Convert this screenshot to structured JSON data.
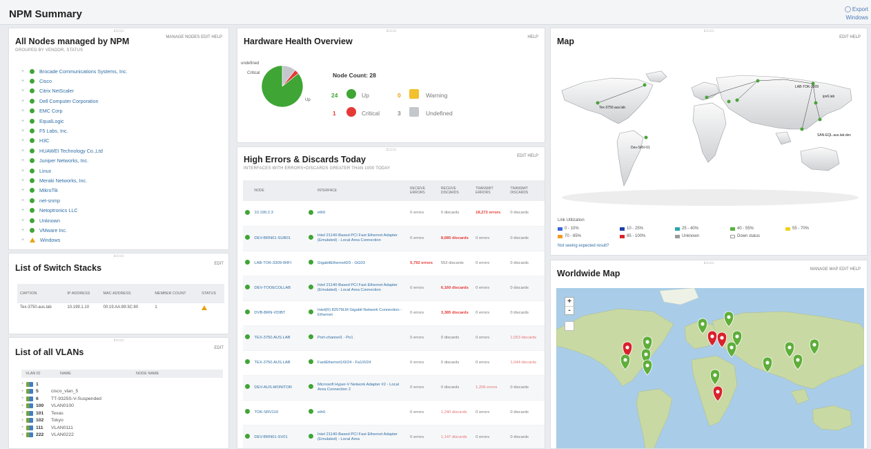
{
  "header": {
    "title": "NPM Summary",
    "export_line1": "Export",
    "export_line2": "Windows"
  },
  "nodes_panel": {
    "title": "All Nodes managed by NPM",
    "subtitle": "GROUPED BY VENDOR, STATUS",
    "links": "MANAGE NODES  EDIT  HELP",
    "items": [
      {
        "label": "Brocade Communications Systems, Inc.",
        "status": "up"
      },
      {
        "label": "Cisco",
        "status": "up"
      },
      {
        "label": "Citrix NetScaler",
        "status": "up"
      },
      {
        "label": "Dell Computer Corporation",
        "status": "up"
      },
      {
        "label": "EMC Corp",
        "status": "up"
      },
      {
        "label": "EqualLogic",
        "status": "up"
      },
      {
        "label": "F5 Labs, Inc.",
        "status": "up"
      },
      {
        "label": "H3C",
        "status": "up"
      },
      {
        "label": "HUAWEI Technology Co.,Ltd",
        "status": "up"
      },
      {
        "label": "Juniper Networks, Inc.",
        "status": "up"
      },
      {
        "label": "Linux",
        "status": "up"
      },
      {
        "label": "Meraki Networks, Inc.",
        "status": "up"
      },
      {
        "label": "MikroTik",
        "status": "up"
      },
      {
        "label": "net-snmp",
        "status": "up"
      },
      {
        "label": "Netoptronics LLC",
        "status": "up"
      },
      {
        "label": "Unknown",
        "status": "up"
      },
      {
        "label": "VMware Inc.",
        "status": "up"
      },
      {
        "label": "Windows",
        "status": "warning"
      }
    ]
  },
  "switch_panel": {
    "title": "List of Switch Stacks",
    "links": "EDIT",
    "columns": [
      "CAPTION",
      "IP ADDRESS",
      "MAC ADDRESS",
      "MEMBER COUNT",
      "STATUS"
    ],
    "rows": [
      {
        "caption": "Tex-3750.aus.lab",
        "ip": "10.199.1.10",
        "mac": "00:19:AA:89:3C:80",
        "count": "1"
      }
    ]
  },
  "vlan_panel": {
    "title": "List of all VLANs",
    "links": "EDIT",
    "columns": [
      "VLAN ID",
      "NAME",
      "NODE NAME"
    ],
    "rows": [
      {
        "id": "1",
        "name": ""
      },
      {
        "id": "5",
        "name": "cisco_vlan_5"
      },
      {
        "id": "6",
        "name": "TT-9325S-V-Suspended"
      },
      {
        "id": "100",
        "name": "VLAN0100"
      },
      {
        "id": "101",
        "name": "Texas"
      },
      {
        "id": "102",
        "name": "Tokyo"
      },
      {
        "id": "111",
        "name": "VLAN0111"
      },
      {
        "id": "222",
        "name": "VLAN0222"
      }
    ]
  },
  "hardware_panel": {
    "title": "Hardware Health Overview",
    "links": "HELP",
    "pie_labels": {
      "undefined": "undefined",
      "critical": "Critical",
      "up": "Up"
    },
    "node_count_label": "Node Count: 28",
    "up_count": "24",
    "up_label": "Up",
    "warning_count": "0",
    "warning_label": "Warning",
    "critical_count": "1",
    "critical_label": "Critical",
    "undefined_count": "3",
    "undefined_label": "Undefined",
    "pie": {
      "up": 24,
      "critical": 1,
      "undefined": 3,
      "warning": 0
    },
    "colors": {
      "up": "#3fa535",
      "critical": "#e53935",
      "warning": "#f2c12e",
      "undefined": "#c4c7cc"
    }
  },
  "errors_panel": {
    "title": "High Errors & Discards Today",
    "subtitle": "INTERFACES WITH ERRORS+DISCARDS GREATER THAN 1000 TODAY",
    "links": "EDIT  HELP",
    "columns": [
      "NODE",
      "INTERFACE",
      "RECEIVE ERRORS",
      "RECEIVE DISCARDS",
      "TRANSMIT ERRORS",
      "TRANSMIT DISCARDS"
    ],
    "rows": [
      {
        "node": "10.199.2.3",
        "iface": "eth0",
        "rx_err": "0 errors",
        "rx_dis": "0 discards",
        "tx_err": "18,272 errors",
        "tx_dis": "0 discards",
        "hl": "tx_err"
      },
      {
        "node": "DEV-BRN01-SUB01",
        "iface": "Intel 21140-Based PCI Fast Ethernet Adapter (Emulated) - Local Area Connection",
        "rx_err": "0 errors",
        "rx_dis": "8,685 discards",
        "tx_err": "0 errors",
        "tx_dis": "0 discards",
        "hl": "rx_dis"
      },
      {
        "node": "LAB-TOK-3309-WIFI",
        "iface": "GigabitEthernet0/3 - GG03",
        "rx_err": "5,792 errors",
        "rx_dis": "553 discards",
        "tx_err": "0 errors",
        "tx_dis": "0 discards",
        "hl": "rx_err"
      },
      {
        "node": "DEV-TOOECOLLAB",
        "iface": "Intel 21140-Based PCI Fast Ethernet Adapter (Emulated) - Local Area Connection",
        "rx_err": "0 errors",
        "rx_dis": "6,160 discards",
        "tx_err": "0 errors",
        "tx_dis": "0 discards",
        "hl": "rx_dis"
      },
      {
        "node": "DVB-BRN-VDIBT",
        "iface": "Intel(R) 82579LM Gigabit Network Connection - Ethernet",
        "rx_err": "0 errors",
        "rx_dis": "3,385 discards",
        "tx_err": "0 errors",
        "tx_dis": "0 discards",
        "hl": "rx_dis"
      },
      {
        "node": "TEX-3750.AUS.LAB",
        "iface": "Port-channel1 - Po1",
        "rx_err": "0 errors",
        "rx_dis": "0 discards",
        "tx_err": "0 errors",
        "tx_dis": "1,053 discards",
        "hl": "tx_dis_soft"
      },
      {
        "node": "TEX-3750.AUS.LAB",
        "iface": "FastEthernet1/0/24 - Fa1/0/24",
        "rx_err": "0 errors",
        "rx_dis": "0 discards",
        "tx_err": "0 errors",
        "tx_dis": "1,044 discards",
        "hl": "tx_dis_soft"
      },
      {
        "node": "DEV-AUS-MONITOR",
        "iface": "Microsoft Hyper-V Network Adapter #2 - Local Area Connection 2",
        "rx_err": "0 errors",
        "rx_dis": "0 discards",
        "tx_err": "1,206 errors",
        "tx_dis": "0 discards",
        "hl": "tx_err_soft"
      },
      {
        "node": "TOK-SRV110",
        "iface": "eth0",
        "rx_err": "0 errors",
        "rx_dis": "1,240 discards",
        "tx_err": "0 errors",
        "tx_dis": "0 discards",
        "hl": "rx_dis_soft"
      },
      {
        "node": "DEV-BRN01-SV01",
        "iface": "Intel 21140-Based PCI Fast Ethernet Adapter (Emulated) - Local Area",
        "rx_err": "0 errors",
        "rx_dis": "1,147 discards",
        "tx_err": "0 errors",
        "tx_dis": "0 discards",
        "hl": "rx_dis_soft"
      }
    ]
  },
  "map_panel": {
    "title": "Map",
    "links": "EDIT  HELP",
    "labels": [
      "Tex-3750.aus.lab",
      "LAB-TOK-3309",
      "ipv6.lab",
      "Dev-SRV-01",
      "SAN-EQL.aus.lab.dev"
    ],
    "legend_title": "Link Utilization",
    "legend": [
      {
        "label": "0 - 10%",
        "color": "#3c63d8"
      },
      {
        "label": "10 - 25%",
        "color": "#1f3ea6"
      },
      {
        "label": "25 - 40%",
        "color": "#2aa7a7"
      },
      {
        "label": "40 - 55%",
        "color": "#56b33c"
      },
      {
        "label": "55 - 70%",
        "color": "#f0d21a"
      },
      {
        "label": "70 - 85%",
        "color": "#f39a22"
      },
      {
        "label": "85 - 100%",
        "color": "#d7262b"
      },
      {
        "label": "Unknown",
        "color": "#9a9a9a"
      },
      {
        "label": "Down status",
        "color": "#ffffff"
      }
    ],
    "help_link": "Not seeing expected result?"
  },
  "worldwide_panel": {
    "title": "Worldwide Map",
    "links": "MANAGE MAP  EDIT  HELP",
    "zoom_in": "+",
    "zoom_out": "-",
    "pin_colors": {
      "up": "#5fae3a",
      "down": "#d8222c"
    }
  }
}
